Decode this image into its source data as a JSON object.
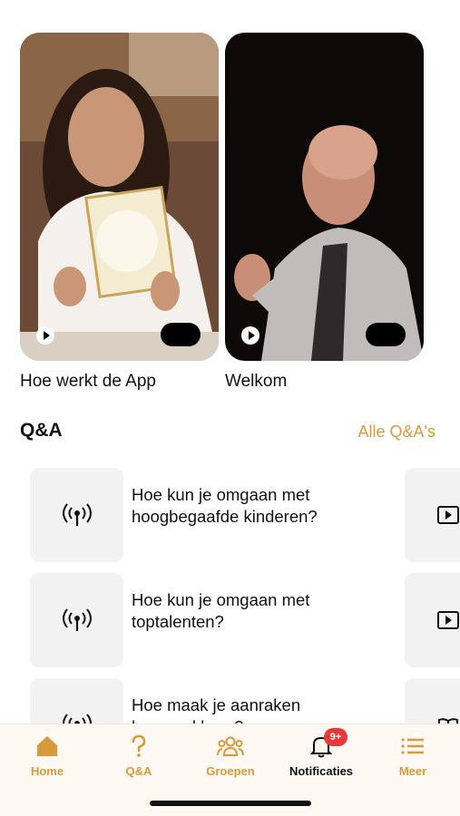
{
  "videos": [
    {
      "title": "Hoe werkt de App"
    },
    {
      "title": "Welkom"
    }
  ],
  "qa": {
    "title": "Q&A",
    "all_link": "Alle Q&A's",
    "items": [
      {
        "text": "Hoe kun je omgaan met hoogbegaafde kinderen?",
        "icon": "broadcast-icon",
        "side_icon": "play-icon"
      },
      {
        "text": "Hoe kun je omgaan met toptalenten?",
        "icon": "broadcast-icon",
        "side_icon": "play-icon"
      },
      {
        "text": "Hoe maak je aanraken bespreekbaar?",
        "icon": "broadcast-icon",
        "side_icon": "book-icon"
      }
    ]
  },
  "nav": {
    "items": [
      {
        "label": "Home",
        "icon": "home-icon"
      },
      {
        "label": "Q&A",
        "icon": "question-icon"
      },
      {
        "label": "Groepen",
        "icon": "groups-icon"
      },
      {
        "label": "Notificaties",
        "icon": "bell-icon",
        "badge": "9+"
      },
      {
        "label": "Meer",
        "icon": "menu-icon"
      }
    ]
  },
  "colors": {
    "accent": "#d89a3a",
    "badge": "#e8393a",
    "nav_bg": "#fdf8f1",
    "tile_bg": "#f2f2f2"
  }
}
